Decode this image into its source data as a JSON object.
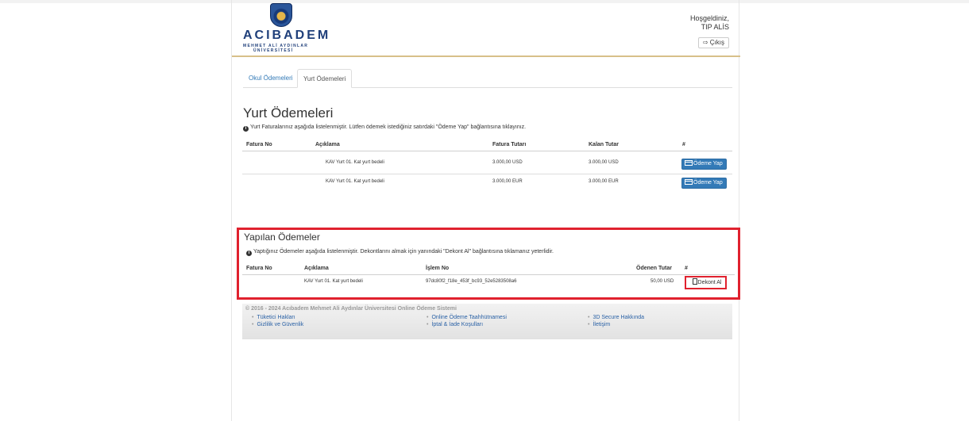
{
  "header": {
    "brand_name": "ACIBADEM",
    "brand_sub_1": "MEHMET ALİ AYDINLAR",
    "brand_sub_2": "ÜNİVERSİTESİ",
    "welcome_line1": "Hoşgeldiniz,",
    "welcome_line2": "TIP ALİS",
    "logout_label": "Çıkış"
  },
  "tabs": [
    {
      "label": "Okul Ödemeleri",
      "active": false
    },
    {
      "label": "Yurt Ödemeleri",
      "active": true
    }
  ],
  "yurt": {
    "title": "Yurt Ödemeleri",
    "info": "Yurt Faturalarınız aşağıda listelenmiştir. Lütfen ödemek istediğiniz satırdaki \"Ödeme Yap\" bağlantısına tıklayınız.",
    "columns": [
      "Fatura No",
      "Açıklama",
      "Fatura Tutarı",
      "Kalan Tutar",
      "#"
    ],
    "rows": [
      {
        "fatura_no": "",
        "aciklama": "KAV Yurt 01. Kat yurt bedeli",
        "fatura_tutari": "3.000,00 USD",
        "kalan_tutar": "3.000,00 USD",
        "action": "Ödeme Yap"
      },
      {
        "fatura_no": "",
        "aciklama": "KAV Yurt 01. Kat yurt bedeli",
        "fatura_tutari": "3.000,00 EUR",
        "kalan_tutar": "3.000,00 EUR",
        "action": "Ödeme Yap"
      }
    ]
  },
  "paid": {
    "title": "Yapılan Ödemeler",
    "info": "Yaptığınız Ödemeler aşağıda listelenmiştir. Dekontlarını almak için yanındaki \"Dekont Al\" bağlantısına tıklamanız yeterlidir.",
    "columns": [
      "Fatura No",
      "Açıklama",
      "İşlem No",
      "Ödenen Tutar",
      "#"
    ],
    "rows": [
      {
        "fatura_no": "",
        "aciklama": "KAV Yurt 01. Kat yurt bedeli",
        "islem_no": "97dc80f2_f18e_453f_bc93_52e5283508a6",
        "odenen_tutar": "50,00 USD",
        "action": "Dekont Al"
      }
    ]
  },
  "footer": {
    "copyright": "© 2016 - 2024 Acıbadem Mehmet Ali Aydınlar Üniversitesi Online Ödeme Sistemi",
    "links": [
      "Tüketici Hakları",
      "Online Ödeme Taahhütnamesi",
      "3D Secure Hakkında",
      "Gizlilik ve Güvenlik",
      "İptal & İade Koşulları",
      "İletişim"
    ]
  },
  "colors": {
    "accent": "#337ab7",
    "highlight": "#e0212e",
    "header_rule": "#d8c08a"
  }
}
